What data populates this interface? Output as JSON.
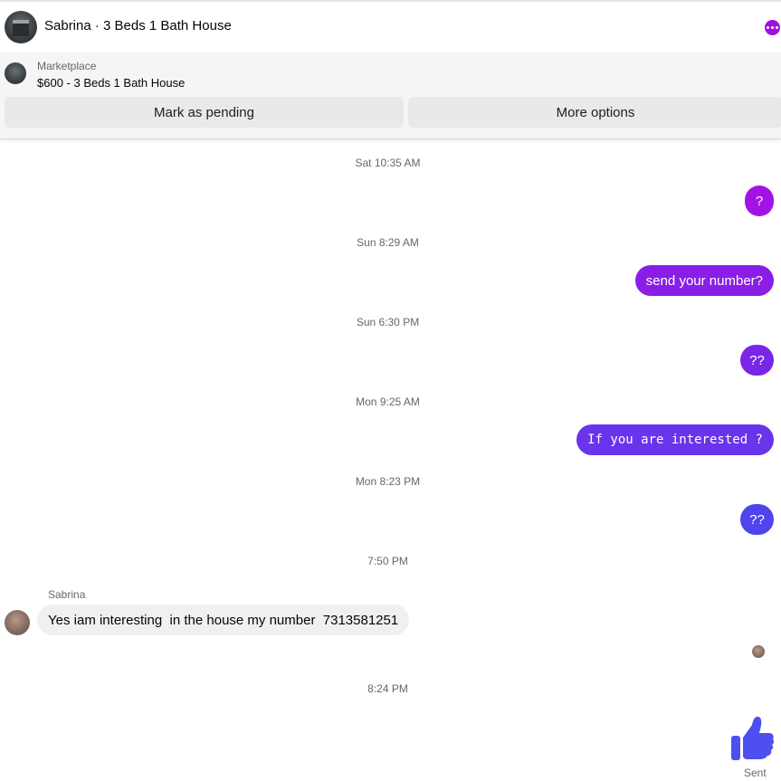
{
  "header": {
    "title": "Sabrina · 3 Beds 1 Bath House",
    "accent_color": "#a30fe0"
  },
  "listing": {
    "label": "Marketplace",
    "text": "$600 - 3 Beds 1 Bath House",
    "buttons": {
      "mark_pending": "Mark as pending",
      "more_options": "More options"
    }
  },
  "messages": [
    {
      "timestamp": "Sat 10:35 AM",
      "text": "?",
      "direction": "outgoing",
      "color": "#a312e4"
    },
    {
      "timestamp": "Sun 8:29 AM",
      "text": "send your number?",
      "direction": "outgoing",
      "color": "#8a1ee6"
    },
    {
      "timestamp": "Sun 6:30 PM",
      "text": "??",
      "direction": "outgoing",
      "color": "#7a26e8"
    },
    {
      "timestamp": "Mon 9:25 AM",
      "text": "If you are interested ?",
      "direction": "outgoing",
      "color": "#6a33ec"
    },
    {
      "timestamp": "Mon 8:23 PM",
      "text": "??",
      "direction": "outgoing",
      "color": "#4f44ee"
    }
  ],
  "incoming": {
    "timestamp": "7:50 PM",
    "sender": "Sabrina",
    "text": "Yes iam interesting  in the house my number  7313581251"
  },
  "final": {
    "timestamp": "8:24 PM",
    "icon": "thumbs-up-icon",
    "color": "#4d4fee",
    "status": "Sent"
  }
}
